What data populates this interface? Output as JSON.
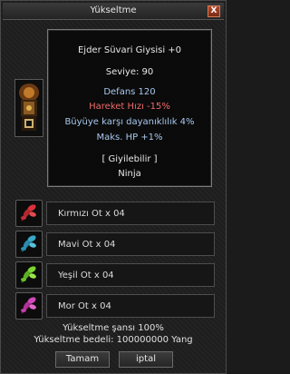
{
  "window": {
    "title": "Yükseltme",
    "close_label": "X"
  },
  "item": {
    "name": "Ejder Süvari Giysisi +0",
    "level": "Seviye: 90",
    "defense": "Defans 120",
    "move_speed": "Hareket Hızı -15%",
    "magic_resist": "Büyüye karşı dayanıklılık 4%",
    "max_hp": "Maks. HP +1%",
    "wearable": "[ Giyilebilir ]",
    "class": "Ninja"
  },
  "materials": [
    {
      "label": "Kırmızı Ot x 04",
      "icon": "red-herb-icon",
      "color": "#d8323a"
    },
    {
      "label": "Mavi Ot x 04",
      "icon": "blue-herb-icon",
      "color": "#3aa8c8"
    },
    {
      "label": "Yeşil Ot x 04",
      "icon": "green-herb-icon",
      "color": "#7bd432"
    },
    {
      "label": "Mor Ot x 04",
      "icon": "purple-herb-icon",
      "color": "#d048b8"
    }
  ],
  "footer": {
    "chance": "Yükseltme şansı 100%",
    "cost": "Yükseltme bedeli: 100000000 Yang"
  },
  "buttons": {
    "ok": "Tamam",
    "cancel": "iptal"
  },
  "colors": {
    "stat_blue": "#a9c9ef",
    "stat_red": "#ef6a6a",
    "text_white": "#e8e8e8"
  }
}
